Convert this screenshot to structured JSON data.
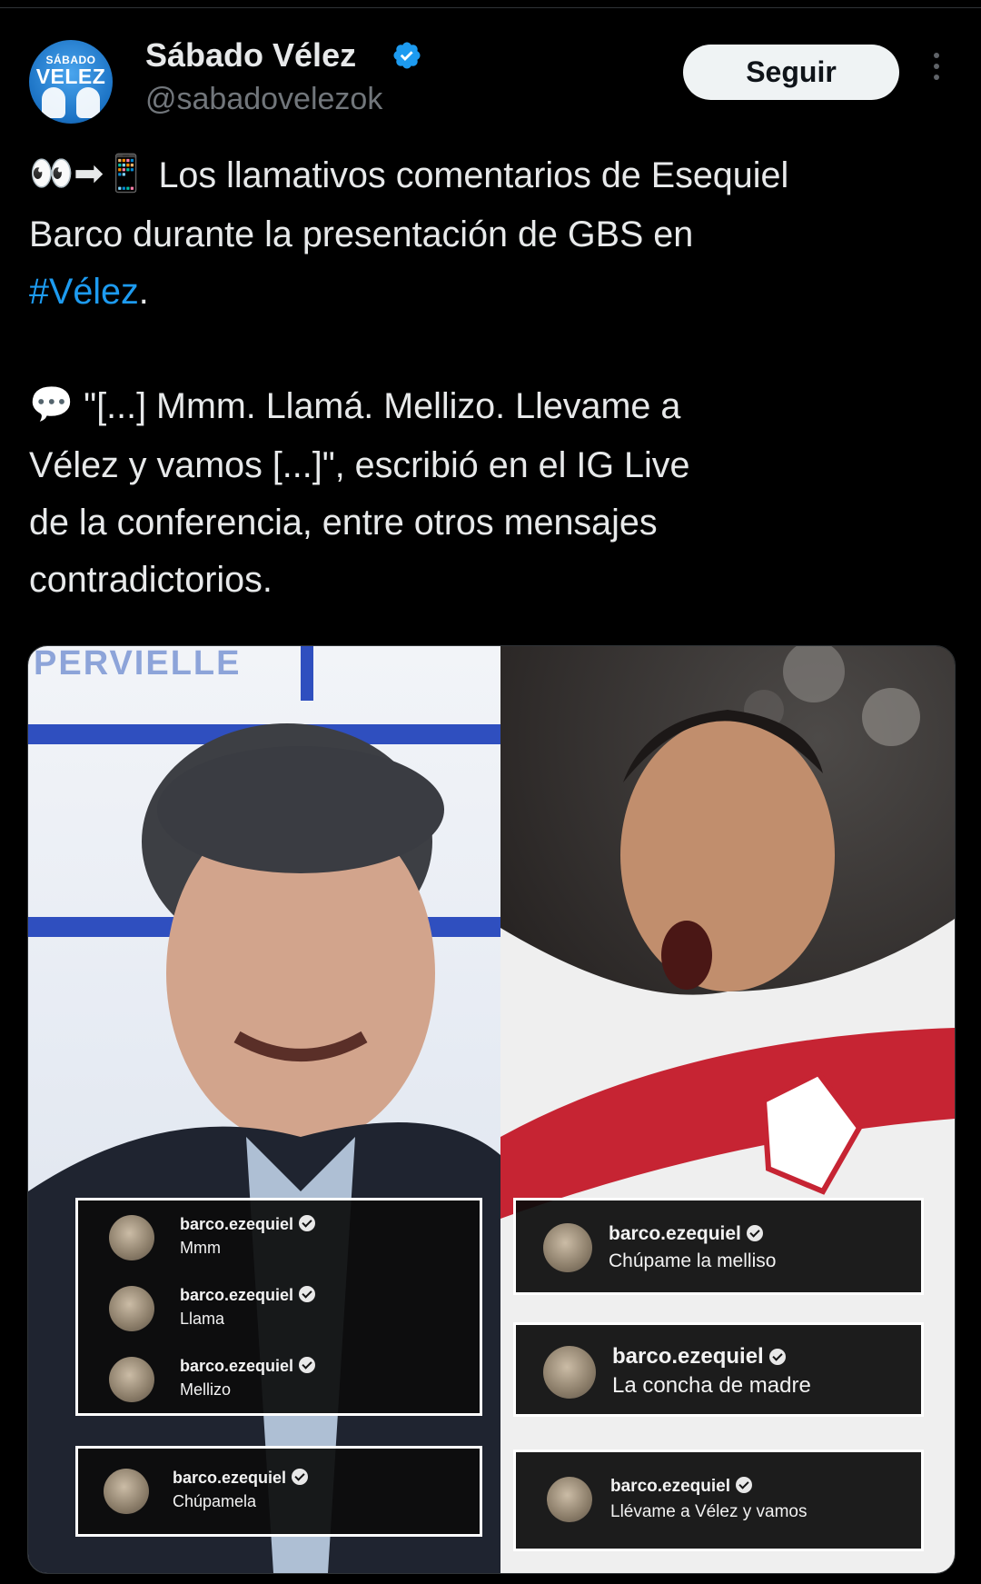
{
  "author": {
    "avatar_text_top": "SÁBADO",
    "avatar_text_bottom": "VELEZ",
    "display_name": "Sábado Vélez",
    "handle": "@sabadovelezok",
    "verified": true,
    "verified_color": "#1d9bf0"
  },
  "actions": {
    "follow_label": "Seguir"
  },
  "tweet": {
    "emoji_line1": "👀➡📱",
    "line1": "Los llamativos comentarios de Esequiel",
    "line2": "Barco durante la presentación de GBS en",
    "hashtag": "#Vélez",
    "hashtag_after": ".",
    "emoji_line4": "💬",
    "line4": "\"[...] Mmm. Llamá. Mellizo. Llevame a",
    "line5": "Vélez y vamos [...]\", escribió en el IG Live",
    "line6": "de la conferencia, entre otros mensajes",
    "line7": "contradictorios."
  },
  "media": {
    "left_background_text": "PERVIELLE",
    "left_comments_group": [
      {
        "user": "barco.ezequiel",
        "message": "Mmm"
      },
      {
        "user": "barco.ezequiel",
        "message": "Llama"
      },
      {
        "user": "barco.ezequiel",
        "message": "Mellizo"
      }
    ],
    "left_comment_single": {
      "user": "barco.ezequiel",
      "message": "Chúpamela"
    },
    "right_comments": [
      {
        "user": "barco.ezequiel",
        "message": "Chúpame la melliso"
      },
      {
        "user": "barco.ezequiel",
        "message": "La concha de madre"
      },
      {
        "user": "barco.ezequiel",
        "message": "Llévame a Vélez y vamos"
      }
    ]
  }
}
